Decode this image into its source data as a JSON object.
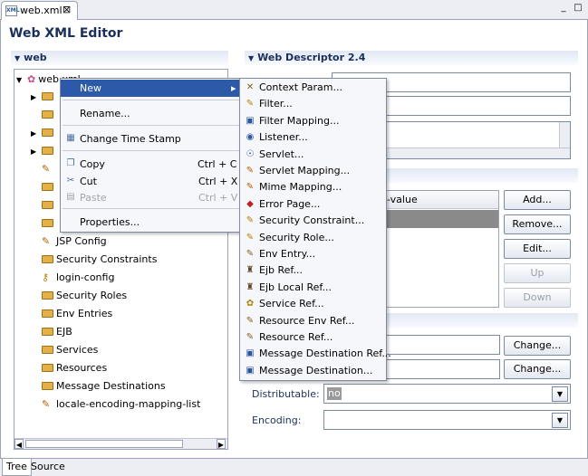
{
  "tab": {
    "title": "web.xml",
    "close": "⊠"
  },
  "window_buttons": {
    "minimize": "_",
    "maximize": "□"
  },
  "editor_title": "Web XML Editor",
  "tree_section": {
    "header": "web",
    "root_label": "web.xml",
    "items": [
      "JSP Config",
      "Security Constraints",
      "login-config",
      "Security Roles",
      "Env Entries",
      "EJB",
      "Services",
      "Resources",
      "Message Destinations",
      "locale-encoding-mapping-list"
    ]
  },
  "descriptor_section": {
    "header": "Web Descriptor 2.4",
    "table_header": "-value",
    "buttons": {
      "add": "Add...",
      "remove": "Remove...",
      "edit": "Edit...",
      "up": "Up",
      "down": "Down",
      "change1": "Change...",
      "change2": "Change..."
    },
    "distributable_label": "Distributable:",
    "distributable_value": "no",
    "encoding_label": "Encoding:",
    "encoding_value": ""
  },
  "context_menu": {
    "items": [
      {
        "label": "New",
        "submenu": "▸"
      },
      {
        "label": "Rename..."
      },
      {
        "label": "Change Time Stamp"
      },
      {
        "label": "Copy",
        "shortcut": "Ctrl + C"
      },
      {
        "label": "Cut",
        "shortcut": "Ctrl + X"
      },
      {
        "label": "Paste",
        "shortcut": "Ctrl + V"
      },
      {
        "label": "Properties..."
      }
    ]
  },
  "submenu": {
    "items": [
      "Context Param...",
      "Filter...",
      "Filter Mapping...",
      "Listener...",
      "Servlet...",
      "Servlet Mapping...",
      "Mime Mapping...",
      "Error Page...",
      "Security Constraint...",
      "Security Role...",
      "Env Entry...",
      "Ejb Ref...",
      "Ejb Local Ref...",
      "Service Ref...",
      "Resource Env Ref...",
      "Resource Ref...",
      "Message Destination Ref...",
      "Message Destination..."
    ]
  },
  "bottom_tabs": [
    "Tree",
    "Source"
  ],
  "colors": {
    "selection": "#2c5aa8",
    "header_text": "#1a2f5a",
    "folder": "#e3b04a"
  }
}
